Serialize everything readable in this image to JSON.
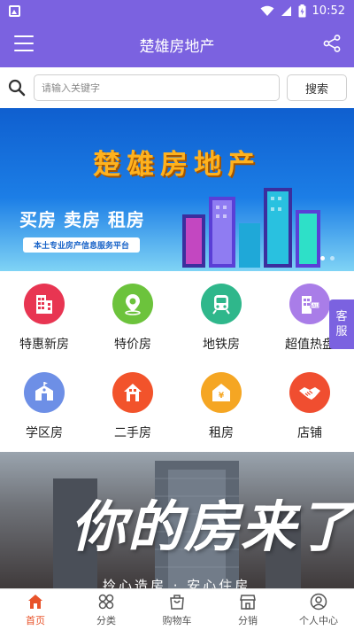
{
  "status_bar": {
    "time": "10:52"
  },
  "header": {
    "title": "楚雄房地产"
  },
  "search": {
    "placeholder": "请输入关键字",
    "button_label": "搜索"
  },
  "banner": {
    "brand": "楚雄房地产",
    "tags": "买房 卖房 租房",
    "slogan": "本土专业房产信息服务平台"
  },
  "categories": [
    {
      "label": "特惠新房",
      "color": "#e83552",
      "icon": "building-icon"
    },
    {
      "label": "特价房",
      "color": "#6cc33c",
      "icon": "map-pin-icon"
    },
    {
      "label": "地铁房",
      "color": "#2fb78b",
      "icon": "subway-icon"
    },
    {
      "label": "超值热盘",
      "color": "#a97de8",
      "icon": "sale-building-icon"
    },
    {
      "label": "学区房",
      "color": "#6d8fe6",
      "icon": "school-icon"
    },
    {
      "label": "二手房",
      "color": "#f2532b",
      "icon": "house-icon"
    },
    {
      "label": "租房",
      "color": "#f5a623",
      "icon": "rent-house-icon"
    },
    {
      "label": "店铺",
      "color": "#f04e30",
      "icon": "handshake-icon"
    }
  ],
  "service": {
    "label_1": "客",
    "label_2": "服"
  },
  "banner2": {
    "bigtext": "你的房来了",
    "subtext": "拎心造房 · 安心住房"
  },
  "tabs": [
    {
      "label": "首页",
      "icon": "home-icon",
      "active": true
    },
    {
      "label": "分类",
      "icon": "category-icon",
      "active": false
    },
    {
      "label": "购物车",
      "icon": "cart-icon",
      "active": false
    },
    {
      "label": "分销",
      "icon": "store-icon",
      "active": false
    },
    {
      "label": "个人中心",
      "icon": "user-icon",
      "active": false
    }
  ],
  "colors": {
    "primary": "#7b62e0",
    "accent": "#e8532a"
  }
}
